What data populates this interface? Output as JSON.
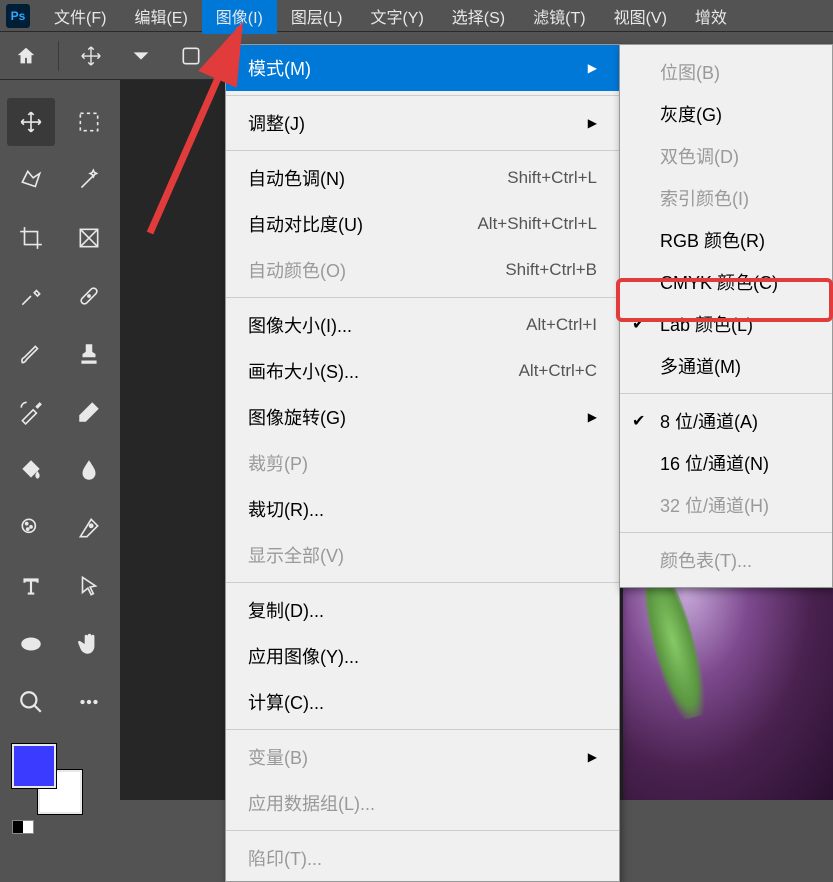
{
  "menubar": {
    "items": [
      "文件(F)",
      "编辑(E)",
      "图像(I)",
      "图层(L)",
      "文字(Y)",
      "选择(S)",
      "滤镜(T)",
      "视图(V)",
      "增效"
    ],
    "activeIndex": 2
  },
  "imageMenu": {
    "mode": {
      "label": "模式(M)",
      "hasSub": true,
      "highlighted": true
    },
    "adjust": {
      "label": "调整(J)",
      "hasSub": true
    },
    "autoTone": {
      "label": "自动色调(N)",
      "shortcut": "Shift+Ctrl+L"
    },
    "autoContrast": {
      "label": "自动对比度(U)",
      "shortcut": "Alt+Shift+Ctrl+L"
    },
    "autoColor": {
      "label": "自动颜色(O)",
      "shortcut": "Shift+Ctrl+B",
      "disabled": true
    },
    "imageSize": {
      "label": "图像大小(I)...",
      "shortcut": "Alt+Ctrl+I"
    },
    "canvasSize": {
      "label": "画布大小(S)...",
      "shortcut": "Alt+Ctrl+C"
    },
    "rotate": {
      "label": "图像旋转(G)",
      "hasSub": true
    },
    "crop": {
      "label": "裁剪(P)",
      "disabled": true
    },
    "trim": {
      "label": "裁切(R)..."
    },
    "revealAll": {
      "label": "显示全部(V)",
      "disabled": true
    },
    "duplicate": {
      "label": "复制(D)..."
    },
    "applyImage": {
      "label": "应用图像(Y)..."
    },
    "calculate": {
      "label": "计算(C)..."
    },
    "variables": {
      "label": "变量(B)",
      "hasSub": true,
      "disabled": true
    },
    "applyData": {
      "label": "应用数据组(L)...",
      "disabled": true
    },
    "trap": {
      "label": "陷印(T)...",
      "disabled": true
    }
  },
  "modeMenu": {
    "bitmap": {
      "label": "位图(B)",
      "disabled": true
    },
    "grayscale": {
      "label": "灰度(G)"
    },
    "duotone": {
      "label": "双色调(D)",
      "disabled": true
    },
    "indexed": {
      "label": "索引颜色(I)",
      "disabled": true
    },
    "rgb": {
      "label": "RGB 颜色(R)"
    },
    "cmyk": {
      "label": "CMYK 颜色(C)"
    },
    "lab": {
      "label": "Lab 颜色(L)",
      "checked": true,
      "boxed": true
    },
    "multi": {
      "label": "多通道(M)"
    },
    "bit8": {
      "label": "8 位/通道(A)",
      "checked": true
    },
    "bit16": {
      "label": "16 位/通道(N)"
    },
    "bit32": {
      "label": "32 位/通道(H)",
      "disabled": true
    },
    "colorTable": {
      "label": "颜色表(T)...",
      "disabled": true
    }
  },
  "colors": {
    "foreground": "#3b3bff",
    "background": "#ffffff"
  }
}
